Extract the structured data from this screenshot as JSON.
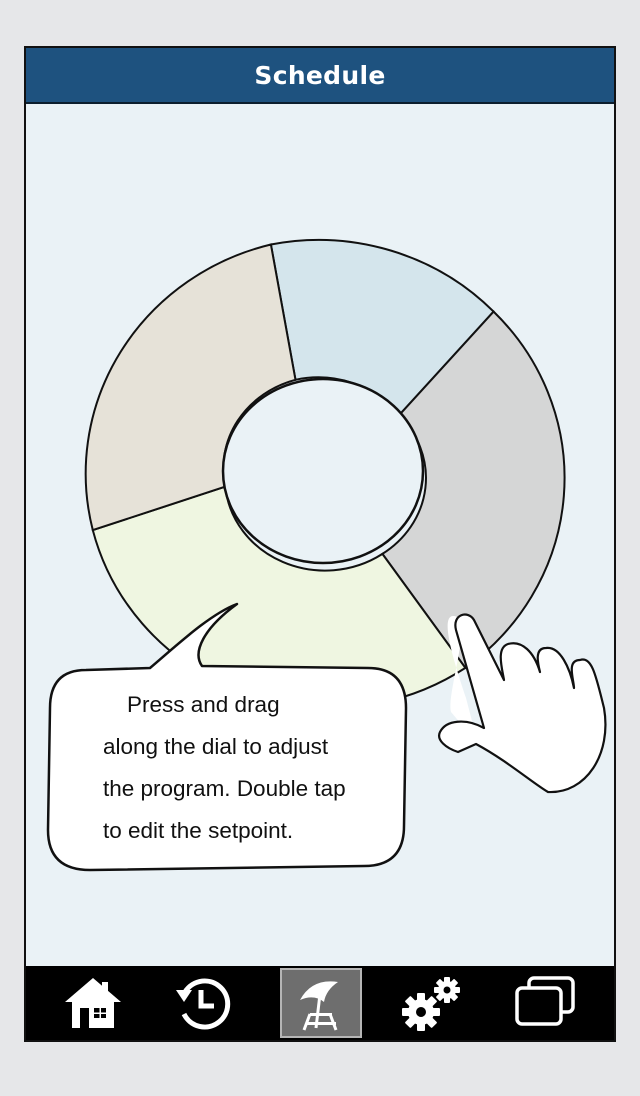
{
  "header": {
    "title": "Schedule"
  },
  "tooltip": {
    "lines": [
      "Press and drag",
      "along the dial to adjust",
      "the program. Double tap",
      "to edit the setpoint."
    ]
  },
  "dial": {
    "segment_colors": [
      "#d4e5ec",
      "#d5d6d6",
      "#eff6e1",
      "#e6e2d8"
    ]
  },
  "navbar": {
    "items": [
      {
        "icon": "home-icon",
        "active": false
      },
      {
        "icon": "history-icon",
        "active": false
      },
      {
        "icon": "vacation-umbrella-icon",
        "active": true
      },
      {
        "icon": "settings-gears-icon",
        "active": false
      },
      {
        "icon": "windows-icon",
        "active": false
      }
    ]
  },
  "colors": {
    "header_bg": "#1e527f",
    "screen_bg": "#eaf2f6",
    "navbar_bg": "#000000",
    "active_tab_bg": "#6e6e6e"
  }
}
